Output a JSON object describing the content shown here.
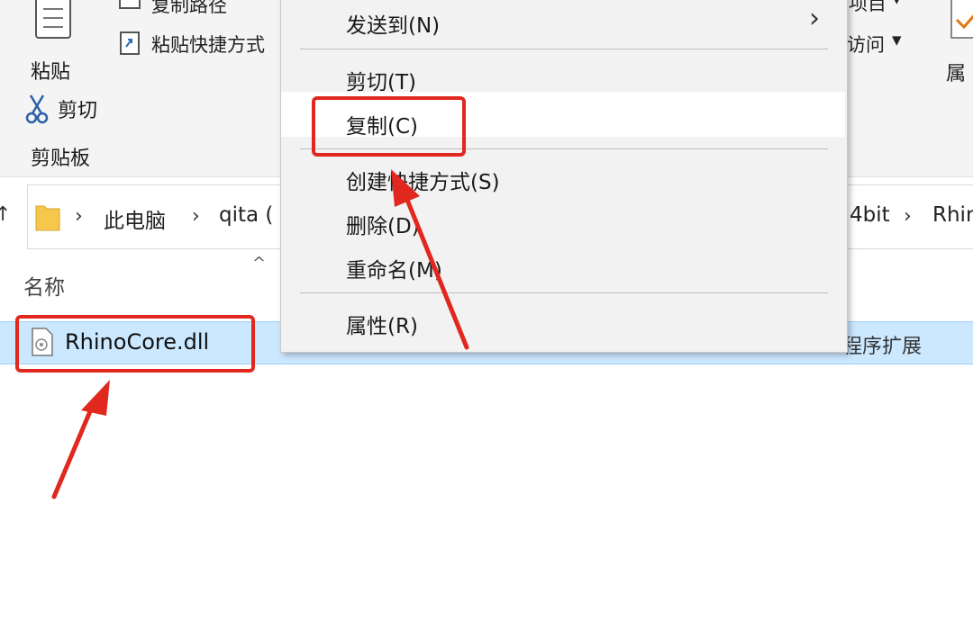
{
  "ribbon": {
    "copy_path": "复制路径",
    "paste_shortcut": "粘贴快捷方式",
    "paste": "粘贴",
    "cut": "剪切",
    "clipboard_group": "剪贴板",
    "right_frag_top": "项目",
    "right_frag_access": "访问",
    "right_frag_prop": "属"
  },
  "address": {
    "this_pc": "此电脑",
    "folder1": "qita (",
    "frag_64bit": "4bit",
    "frag_rhino": "Rhin"
  },
  "list": {
    "column_name": "名称",
    "file_name": "RhinoCore.dll",
    "file_type_frag": "程序扩展"
  },
  "context_menu": {
    "send_to": "发送到(N)",
    "cut": "剪切(T)",
    "copy": "复制(C)",
    "create_shortcut": "创建快捷方式(S)",
    "delete": "删除(D)",
    "rename": "重命名(M)",
    "properties": "属性(R)"
  },
  "colors": {
    "selection": "#cce8ff",
    "annotation_red": "#e0281e",
    "menu_bg": "#f2f2f2"
  }
}
